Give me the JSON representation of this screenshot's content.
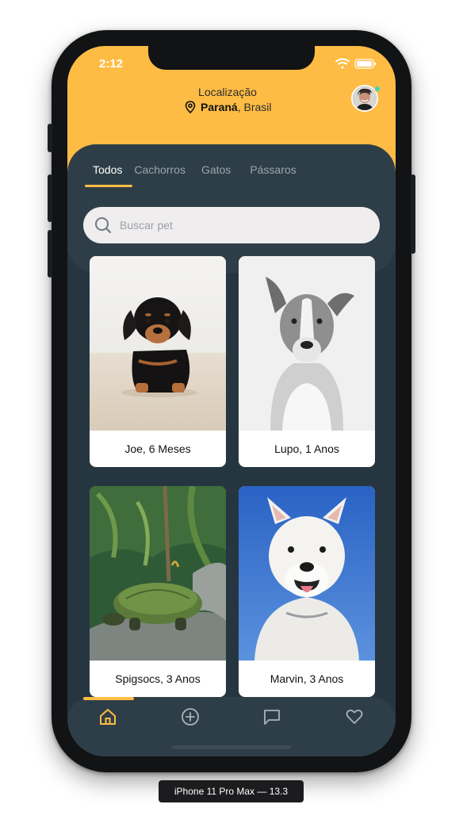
{
  "status_bar": {
    "time": "2:12"
  },
  "header": {
    "location_label": "Localização",
    "state": "Paraná",
    "country": ", Brasil"
  },
  "tabs": [
    {
      "label": "Todos",
      "active": true
    },
    {
      "label": "Cachorros",
      "active": false
    },
    {
      "label": "Gatos",
      "active": false
    },
    {
      "label": "Pássaros",
      "active": false
    }
  ],
  "search": {
    "placeholder": "Buscar pet",
    "value": ""
  },
  "pets": [
    {
      "name": "Joe, 6 Meses"
    },
    {
      "name": "Lupo, 1 Anos"
    },
    {
      "name": "Spigsocs, 3 Anos"
    },
    {
      "name": "Marvin, 3 Anos"
    }
  ],
  "bottom_nav": [
    {
      "icon": "home-icon",
      "active": true
    },
    {
      "icon": "add-circle-icon",
      "active": false
    },
    {
      "icon": "chat-icon",
      "active": false
    },
    {
      "icon": "heart-icon",
      "active": false
    }
  ],
  "colors": {
    "accent": "#ffbc45",
    "background": "#263640",
    "panel": "#2e3e48",
    "search_bg": "#efedee"
  },
  "simulator_label": "iPhone 11 Pro Max — 13.3"
}
